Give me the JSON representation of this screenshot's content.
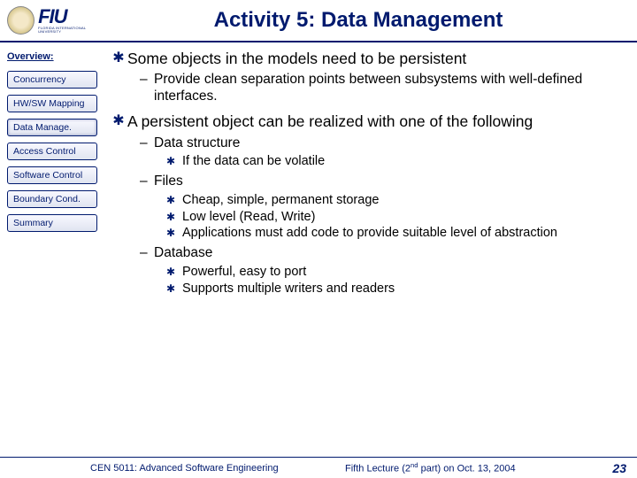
{
  "header": {
    "logo_main": "FIU",
    "logo_sub": "FLORIDA INTERNATIONAL UNIVERSITY",
    "title": "Activity 5: Data Management"
  },
  "sidebar": {
    "overview": "Overview:",
    "items": [
      "Concurrency",
      "HW/SW Mapping",
      "Data Manage.",
      "Access Control",
      "Software Control",
      "Boundary Cond.",
      "Summary"
    ]
  },
  "content": {
    "b1": "Some objects in the models need to be persistent",
    "b1_1": "Provide clean separation points between subsystems with well-defined interfaces.",
    "b2": "A persistent object can be realized with one of the following",
    "b2_1": "Data structure",
    "b2_1_1": "If the data can be volatile",
    "b2_2": "Files",
    "b2_2_1": "Cheap, simple, permanent storage",
    "b2_2_2": "Low level (Read, Write)",
    "b2_2_3": "Applications must add code to provide suitable level of abstraction",
    "b2_3": "Database",
    "b2_3_1": "Powerful, easy to port",
    "b2_3_2": "Supports multiple writers and readers"
  },
  "footer": {
    "left": "CEN 5011: Advanced Software Engineering",
    "mid_html": "Fifth Lecture (2<sup>nd</sup> part) on Oct. 13, 2004",
    "page": "23"
  }
}
